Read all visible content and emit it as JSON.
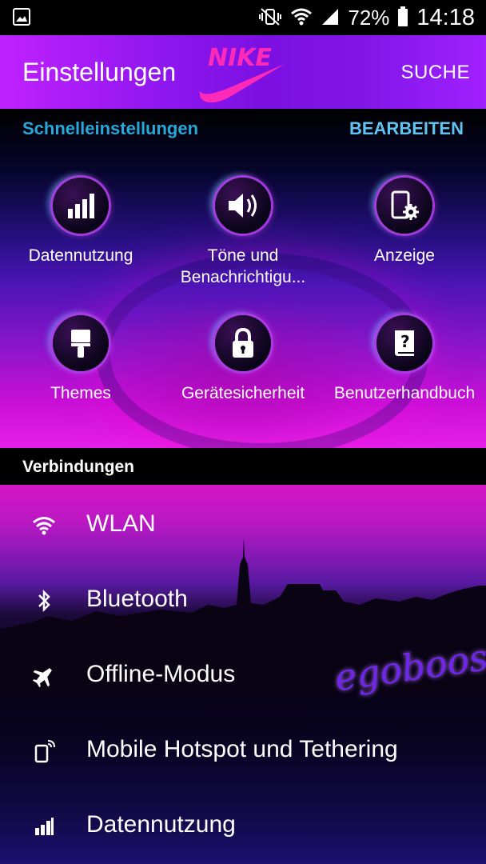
{
  "status_bar": {
    "battery_percent": "72%",
    "time": "14:18",
    "icons": [
      "image-icon",
      "mute-vibrate-icon",
      "wifi-icon",
      "signal-icon",
      "battery-icon"
    ]
  },
  "header": {
    "title": "Einstellungen",
    "search_label": "SUCHE",
    "logo": "nike-swoosh-logo"
  },
  "quick_settings": {
    "title": "Schnelleinstellungen",
    "edit_label": "BEARBEITEN",
    "tiles": [
      {
        "label": "Datennutzung",
        "icon": "data-usage-icon"
      },
      {
        "label": "Töne und Benachrichtigu...",
        "icon": "sound-icon"
      },
      {
        "label": "Anzeige",
        "icon": "display-settings-icon"
      },
      {
        "label": "Themes",
        "icon": "themes-brush-icon"
      },
      {
        "label": "Gerätesicherheit",
        "icon": "lock-icon"
      },
      {
        "label": "Benutzerhandbuch",
        "icon": "help-book-icon"
      }
    ]
  },
  "connections": {
    "title": "Verbindungen",
    "items": [
      {
        "label": "WLAN",
        "icon": "wifi-icon"
      },
      {
        "label": "Bluetooth",
        "icon": "bluetooth-icon"
      },
      {
        "label": "Offline-Modus",
        "icon": "airplane-icon"
      },
      {
        "label": "Mobile Hotspot und Tethering",
        "icon": "hotspot-icon"
      },
      {
        "label": "Datennutzung",
        "icon": "signal-bars-icon"
      }
    ]
  },
  "wallpaper_watermark": "egoboost",
  "colors": {
    "accent_title": "#27a8d9",
    "accent_edit": "#5fc4ef",
    "header_bg": "#8d16ee"
  }
}
